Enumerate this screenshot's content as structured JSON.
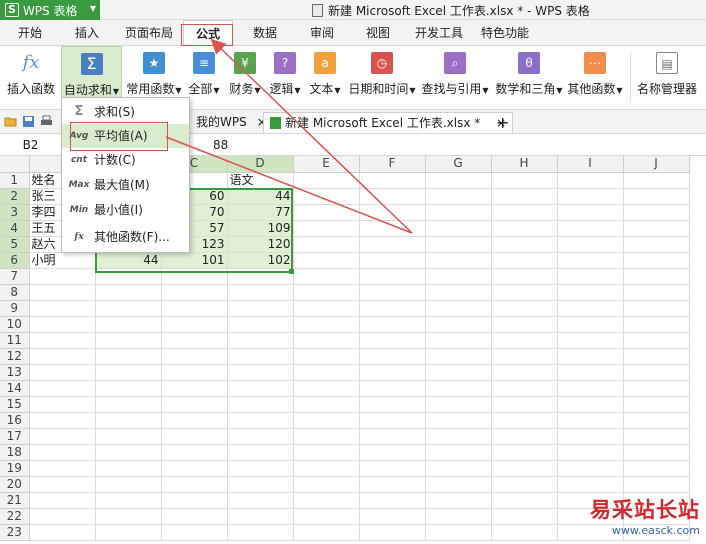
{
  "title_bar": {
    "app_name": "WPS 表格",
    "app_logo_letter": "S",
    "window_title": "新建 Microsoft Excel 工作表.xlsx * - WPS 表格"
  },
  "menu_tabs": [
    "开始",
    "插入",
    "页面布局",
    "公式",
    "数据",
    "审阅",
    "视图",
    "开发工具",
    "特色功能"
  ],
  "active_menu_tab": "公式",
  "ribbon": {
    "insert_function": "插入函数",
    "autosum": "自动求和",
    "common_functions": "常用函数",
    "all": "全部",
    "finance": "财务",
    "logic": "逻辑",
    "text": "文本",
    "datetime": "日期和时间",
    "lookup": "查找与引用",
    "math": "数学和三角",
    "other_functions": "其他函数",
    "name_manager": "名称管理器"
  },
  "doc_tabs": {
    "my_wps": "我的WPS",
    "active_doc": "新建 Microsoft Excel 工作表.xlsx *",
    "add": "+"
  },
  "formula_bar": {
    "cell_ref": "B2",
    "value": "88"
  },
  "grid": {
    "columns": [
      "C",
      "D",
      "E",
      "F",
      "G",
      "H",
      "I",
      "J"
    ],
    "rows": [
      {
        "num": "1",
        "a": "姓名",
        "b": "",
        "c": "",
        "d": "语文"
      },
      {
        "num": "2",
        "a": "张三",
        "b": "",
        "c": "60",
        "d": "44"
      },
      {
        "num": "3",
        "a": "李四",
        "b": "",
        "c": "70",
        "d": "77"
      },
      {
        "num": "4",
        "a": "王五",
        "b": "",
        "c": "57",
        "d": "109"
      },
      {
        "num": "5",
        "a": "赵六",
        "b": "",
        "c": "123",
        "d": "120"
      },
      {
        "num": "6",
        "a": "小明",
        "b": "44",
        "c": "101",
        "d": "102"
      }
    ],
    "empty_rows": [
      "7",
      "8",
      "9",
      "10",
      "11",
      "12",
      "13",
      "14",
      "15",
      "16",
      "17",
      "18",
      "19",
      "20",
      "21",
      "22",
      "23"
    ]
  },
  "autosum_menu": {
    "sum": "求和(S)",
    "average": "平均值(A)",
    "count": "计数(C)",
    "max": "最大值(M)",
    "min": "最小值(I)",
    "more": "其他函数(F)...",
    "icons": {
      "sum": "Σ",
      "average": "Avg",
      "count": "cnt",
      "max": "Max",
      "min": "Min",
      "more": "fx"
    }
  },
  "watermark": {
    "cn": "易采站长站",
    "url": "www.easck.com"
  },
  "colors": {
    "brand_green": "#3a9a3f",
    "selection_fill": "#dff0d4",
    "annotation_red": "#d9534f"
  }
}
